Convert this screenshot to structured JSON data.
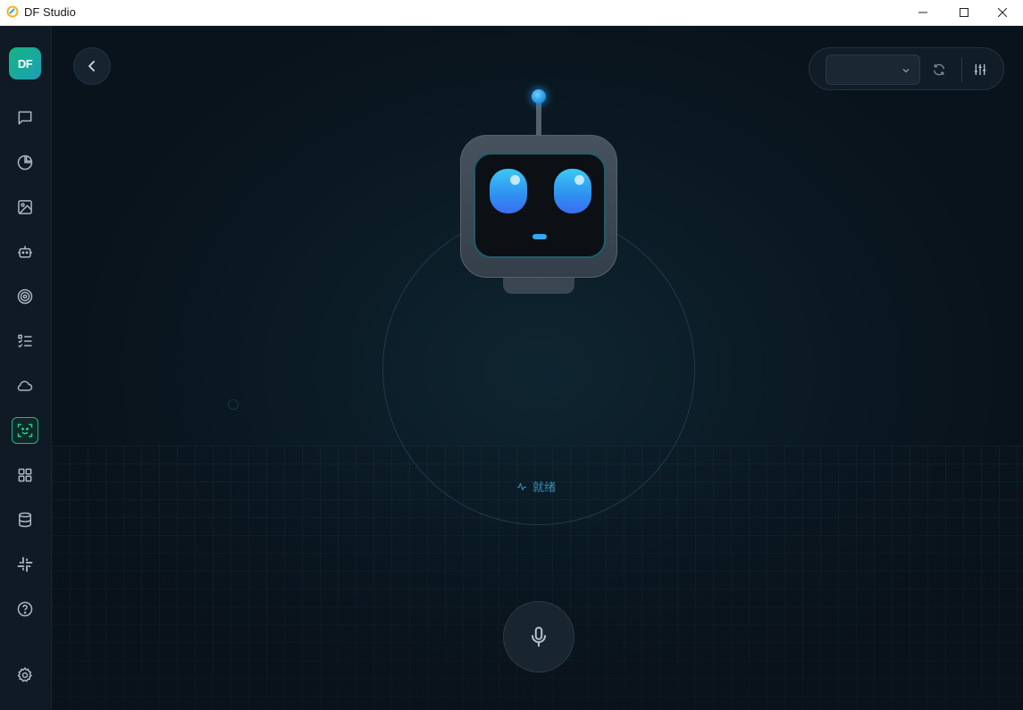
{
  "window": {
    "title": "DF Studio",
    "controls": [
      "minimize",
      "maximize",
      "close"
    ]
  },
  "sidebar": {
    "logo_text": "DF",
    "items": [
      {
        "name": "chat",
        "icon": "message-square-icon"
      },
      {
        "name": "analytics",
        "icon": "pie-chart-icon"
      },
      {
        "name": "images",
        "icon": "image-icon"
      },
      {
        "name": "agents",
        "icon": "robot-icon"
      },
      {
        "name": "target",
        "icon": "target-icon"
      },
      {
        "name": "tasks",
        "icon": "checklist-icon"
      },
      {
        "name": "cloud",
        "icon": "cloud-icon"
      },
      {
        "name": "face",
        "icon": "face-scan-icon",
        "active": true
      },
      {
        "name": "apps",
        "icon": "grid-icon"
      },
      {
        "name": "database",
        "icon": "database-icon"
      },
      {
        "name": "integrations",
        "icon": "slack-icon"
      },
      {
        "name": "help",
        "icon": "help-circle-icon"
      },
      {
        "name": "settings",
        "icon": "gear-icon"
      }
    ]
  },
  "toolbar": {
    "model_value": "",
    "refresh_icon": "refresh-icon",
    "tune_icon": "sliders-icon"
  },
  "robot": {
    "status_text": "就绪",
    "status_icon": "activity-icon"
  },
  "colors": {
    "accent": "#1fb58a",
    "eye": "#3cc8f5",
    "status": "#2f93b8",
    "background": "#0b1620"
  }
}
